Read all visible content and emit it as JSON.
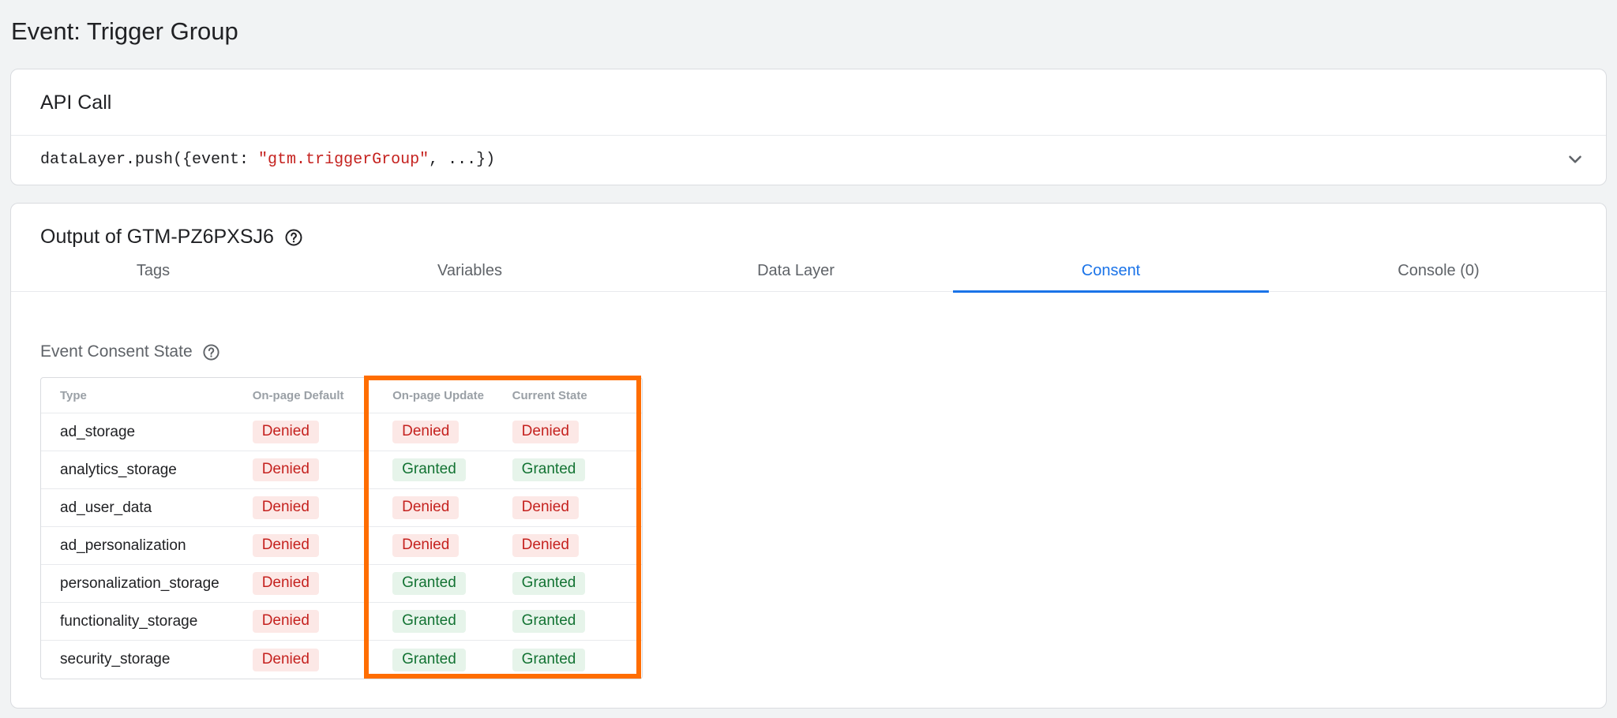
{
  "page_title": "Event: Trigger Group",
  "api_call": {
    "header": "API Call",
    "code_prefix": "dataLayer.push({event: ",
    "code_string": "\"gtm.triggerGroup\"",
    "code_suffix": ", ...})"
  },
  "output": {
    "title": "Output of GTM-PZ6PXSJ6",
    "tabs": [
      {
        "label": "Tags"
      },
      {
        "label": "Variables"
      },
      {
        "label": "Data Layer"
      },
      {
        "label": "Consent"
      },
      {
        "label": "Console (0)"
      }
    ],
    "active_tab": "Consent",
    "section_title": "Event Consent State",
    "table": {
      "headers": [
        "Type",
        "On-page Default",
        "On-page Update",
        "Current State"
      ],
      "rows": [
        [
          "ad_storage",
          "Denied",
          "Denied",
          "Denied"
        ],
        [
          "analytics_storage",
          "Denied",
          "Granted",
          "Granted"
        ],
        [
          "ad_user_data",
          "Denied",
          "Denied",
          "Denied"
        ],
        [
          "ad_personalization",
          "Denied",
          "Denied",
          "Denied"
        ],
        [
          "personalization_storage",
          "Denied",
          "Granted",
          "Granted"
        ],
        [
          "functionality_storage",
          "Denied",
          "Granted",
          "Granted"
        ],
        [
          "security_storage",
          "Denied",
          "Granted",
          "Granted"
        ]
      ]
    }
  },
  "colors": {
    "accent": "#1a73e8",
    "denied_bg": "#fce8e6",
    "denied_text": "#c5221f",
    "granted_bg": "#e6f4ea",
    "granted_text": "#137333",
    "highlight": "#ff6d00"
  }
}
